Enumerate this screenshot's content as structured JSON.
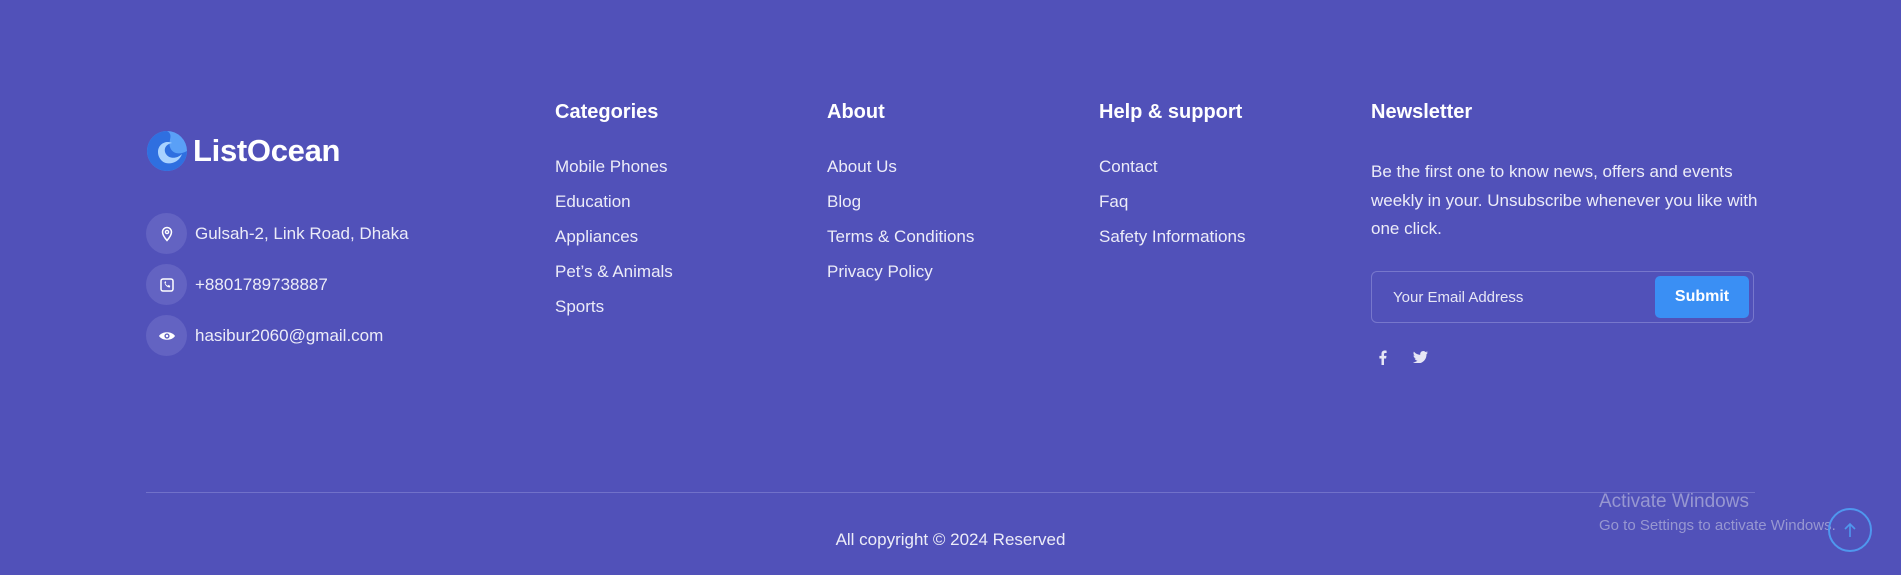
{
  "brand": {
    "name": "ListOcean"
  },
  "contact": {
    "address": "Gulsah-2, Link Road, Dhaka",
    "phone": "+8801789738887",
    "email": "hasibur2060@gmail.com",
    "icons": [
      "map-pin-icon",
      "phone-icon",
      "eye-icon"
    ]
  },
  "categories": {
    "title": "Categories",
    "links": [
      "Mobile Phones",
      "Education",
      "Appliances",
      "Pet’s & Animals",
      "Sports"
    ]
  },
  "about": {
    "title": "About",
    "links": [
      "About Us",
      "Blog",
      "Terms & Conditions",
      "Privacy Policy"
    ]
  },
  "help": {
    "title": "Help & support",
    "links": [
      "Contact",
      "Faq",
      "Safety Informations"
    ]
  },
  "newsletter": {
    "title": "Newsletter",
    "text": "Be the first one to know news, offers and events weekly in your. Unsubscribe whenever you like with one click.",
    "placeholder": "Your Email Address",
    "submit_label": "Submit",
    "social_icons": [
      "facebook-icon",
      "twitter-icon"
    ]
  },
  "footer": {
    "copyright": "All copyright © 2024 Reserved"
  },
  "watermark": {
    "title": "Activate Windows",
    "subtitle": "Go to Settings to activate Windows."
  },
  "colors": {
    "background": "#5151b9",
    "accent": "#3a8ff4"
  }
}
